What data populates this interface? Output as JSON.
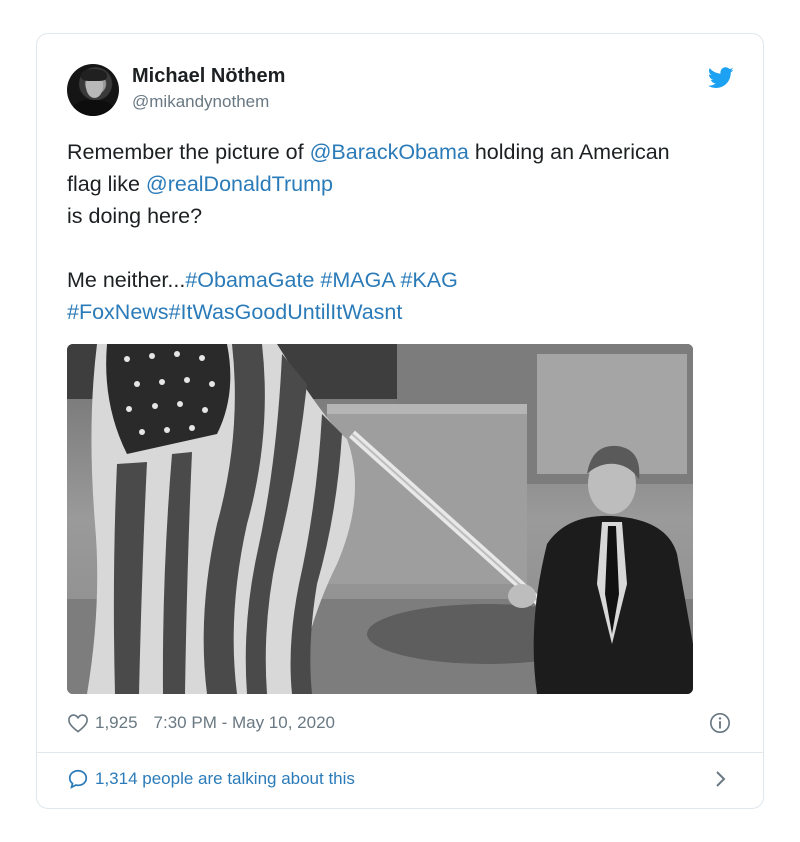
{
  "author": {
    "name": "Michael Nöthem",
    "handle": "@mikandynothem"
  },
  "tweet": {
    "line1_pre": "Remember the picture of ",
    "mention1": "@BarackObama",
    "line1_post": " holding an American",
    "line2_pre": "flag like ",
    "mention2": "@realDonaldTrump",
    "line3": "is doing here?",
    "line4_pre": "Me neither...",
    "hashtag1": "#ObamaGate",
    "hashtag2": "#MAGA",
    "hashtag3": "#KAG",
    "hashtag4": "#FoxNews",
    "hashtag5": "#ItWasGoodUntilItWasnt"
  },
  "meta": {
    "likes": "1,925",
    "timestamp": "7:30 PM - May 10, 2020"
  },
  "footer": {
    "talking": "1,314 people are talking about this"
  },
  "colors": {
    "link": "#2b7bb9",
    "secondary": "#697882",
    "border": "#e1e8ed",
    "twitter_blue": "#1da1f2"
  },
  "icons": [
    "twitter-bird-icon",
    "heart-icon",
    "info-icon",
    "reply-bubble-icon",
    "chevron-right-icon"
  ]
}
